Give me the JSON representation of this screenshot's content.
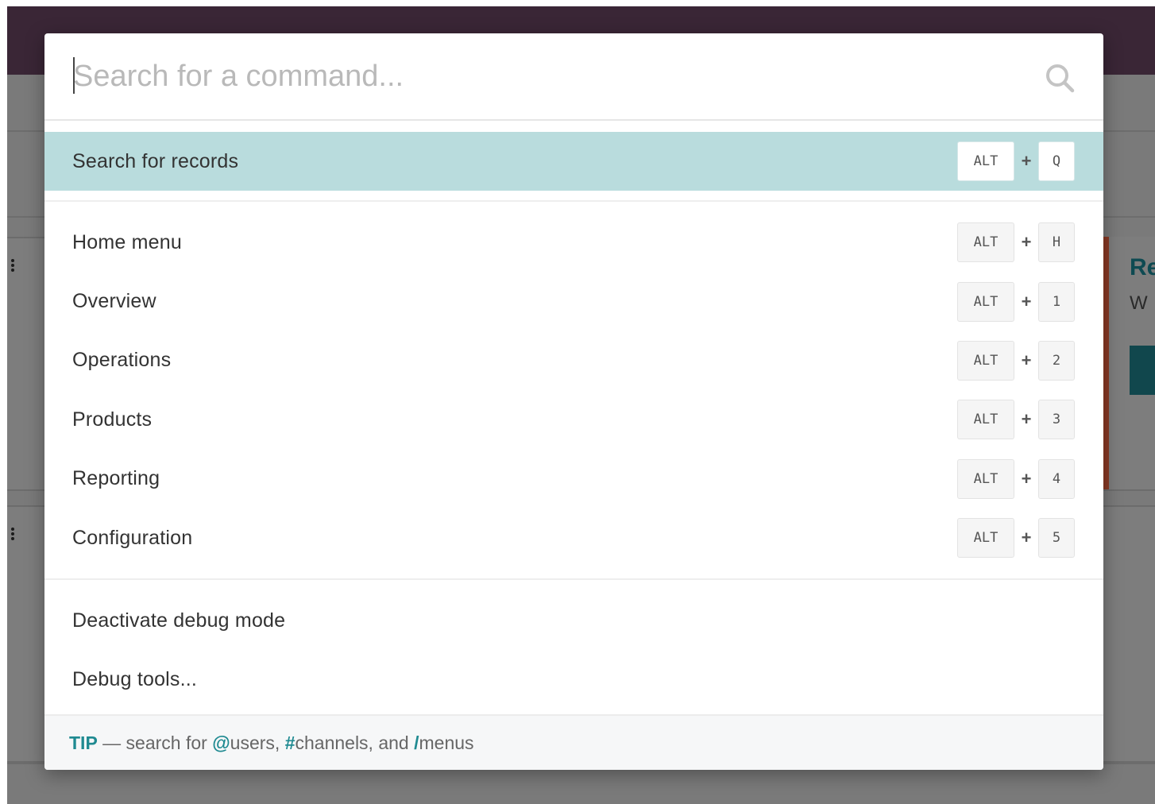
{
  "palette": {
    "search": {
      "placeholder": "Search for a command...",
      "value": ""
    },
    "first_section": [
      {
        "label": "Search for records",
        "keys": [
          "ALT",
          "Q"
        ],
        "active": true
      }
    ],
    "nav_section": [
      {
        "label": "Home menu",
        "keys": [
          "ALT",
          "H"
        ]
      },
      {
        "label": "Overview",
        "keys": [
          "ALT",
          "1"
        ]
      },
      {
        "label": "Operations",
        "keys": [
          "ALT",
          "2"
        ]
      },
      {
        "label": "Products",
        "keys": [
          "ALT",
          "3"
        ]
      },
      {
        "label": "Reporting",
        "keys": [
          "ALT",
          "4"
        ]
      },
      {
        "label": "Configuration",
        "keys": [
          "ALT",
          "5"
        ]
      }
    ],
    "debug_section": [
      {
        "label": "Deactivate debug mode"
      },
      {
        "label": "Debug tools..."
      }
    ],
    "shortcut_joiner": "+",
    "tip": {
      "label": "TIP",
      "dash": " — search for ",
      "users_sym": "@",
      "users": "users, ",
      "channels_sym": "#",
      "channels": "channels, and ",
      "menus_sym": "/",
      "menus": "menus"
    }
  },
  "background": {
    "panel_title": "Re",
    "panel_sub": "W"
  },
  "colors": {
    "navbar": "#3a2636",
    "active_row": "#b9dcdd",
    "accent": "#1f8a91"
  }
}
